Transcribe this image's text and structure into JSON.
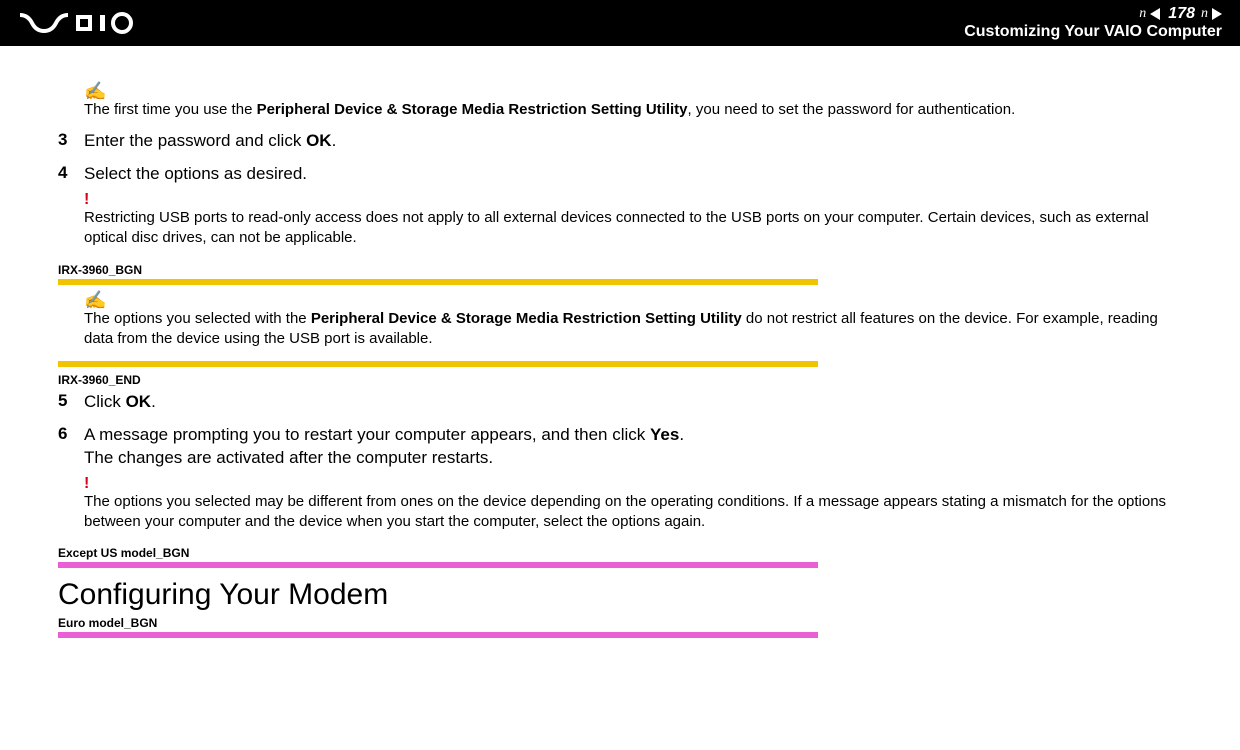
{
  "header": {
    "logo_alt": "VAIO",
    "page_number": "178",
    "nav_n": "n",
    "nav_N_right": "N",
    "section": "Customizing Your VAIO Computer"
  },
  "body": {
    "note1_pre": "The first time you use the ",
    "note1_bold": "Peripheral Device & Storage Media Restriction Setting Utility",
    "note1_post": ", you need to set the password for authentication.",
    "step3_num": "3",
    "step3_pre": "Enter the password and click ",
    "step3_bold": "OK",
    "step3_post": ".",
    "step4_num": "4",
    "step4_text": "Select the options as desired.",
    "warn1": "Restricting USB ports to read-only access does not apply to all external devices connected to the USB ports on your computer. Certain devices, such as external optical disc drives, can not be applicable.",
    "marker_bgn": "IRX-3960_BGN",
    "note2_pre": "The options you selected with the ",
    "note2_bold": "Peripheral Device & Storage Media Restriction Setting Utility",
    "note2_post": " do not restrict all features on the device. For example, reading data from the device using the USB port is available.",
    "marker_end": "IRX-3960_END",
    "step5_num": "5",
    "step5_pre": "Click ",
    "step5_bold": "OK",
    "step5_post": ".",
    "step6_num": "6",
    "step6_pre": "A message prompting you to restart your computer appears, and then click ",
    "step6_bold": "Yes",
    "step6_post": ".",
    "step6_line2": "The changes are activated after the computer restarts.",
    "warn2": "The options you selected may be different from ones on the device depending on the operating conditions. If a message appears stating a mismatch for the options between your computer and the device when you start the computer, select the options again.",
    "marker_except": "Except US model_BGN",
    "h2": "Configuring Your Modem",
    "marker_euro": "Euro model_BGN",
    "excl": "!"
  }
}
